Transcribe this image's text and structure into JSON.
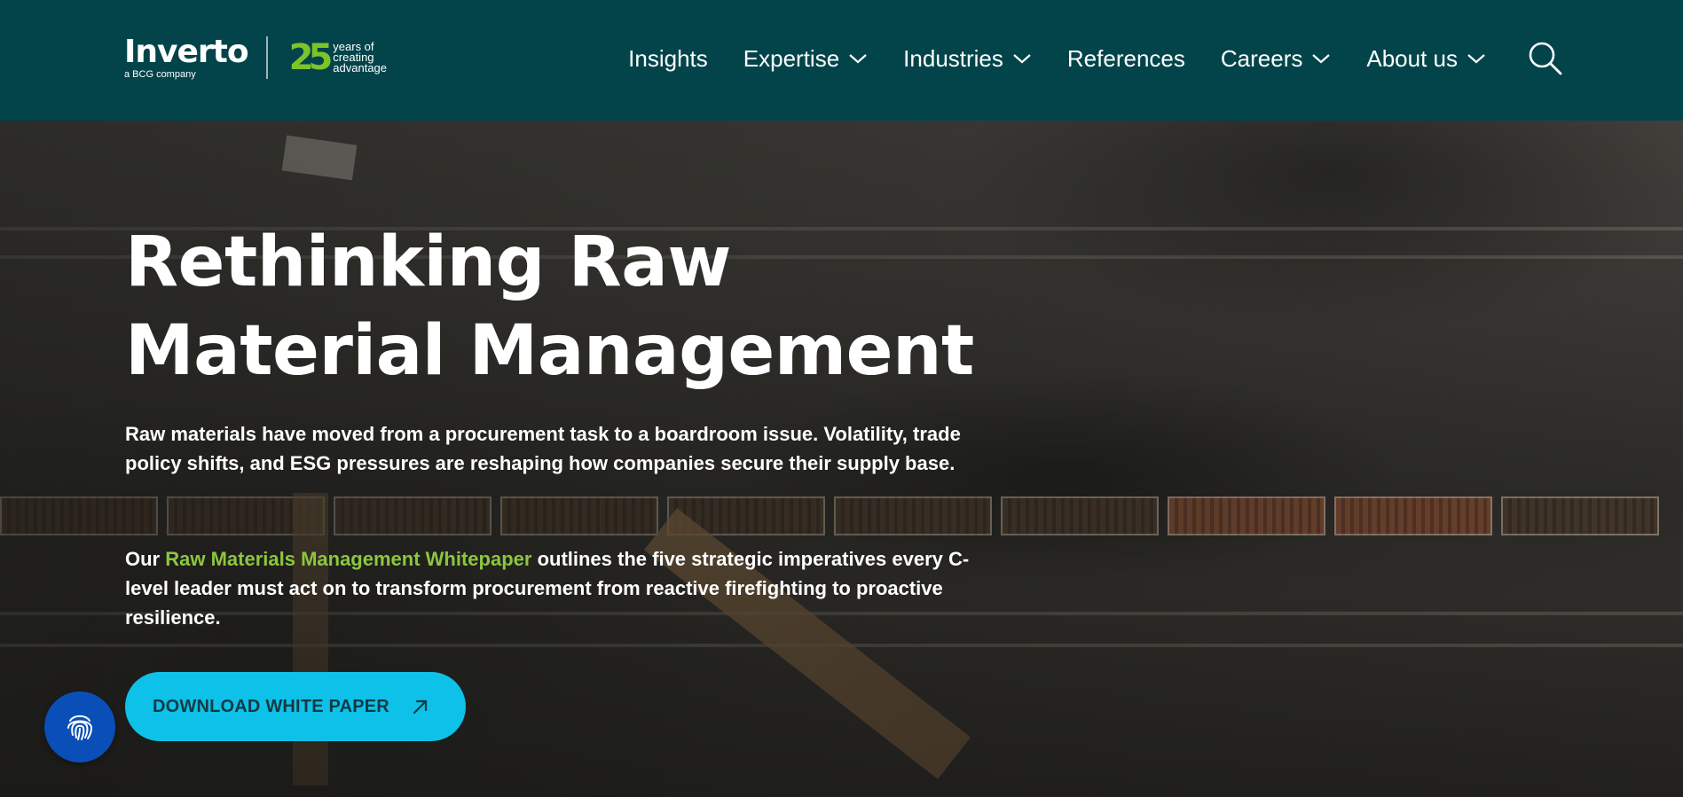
{
  "header": {
    "logo": {
      "name": "Inverto",
      "tagline": "a BCG company"
    },
    "anniversary": {
      "number": "25",
      "lines": [
        "years of",
        "creating",
        "advantage"
      ]
    },
    "nav": [
      {
        "label": "Insights",
        "has_dropdown": false
      },
      {
        "label": "Expertise",
        "has_dropdown": true
      },
      {
        "label": "Industries",
        "has_dropdown": true
      },
      {
        "label": "References",
        "has_dropdown": false
      },
      {
        "label": "Careers",
        "has_dropdown": true
      },
      {
        "label": "About us",
        "has_dropdown": true
      }
    ],
    "search_icon": "search-icon"
  },
  "hero": {
    "title_line1": "Rethinking Raw",
    "title_line2": "Material Management",
    "paragraph1": "Raw materials have moved from a procurement task to a boardroom issue. Volatility, trade policy shifts, and ESG pressures are reshaping how companies secure their supply base.",
    "paragraph2_prefix": "Our ",
    "paragraph2_link": "Raw Materials Management Whitepaper",
    "paragraph2_suffix": " outlines the five strategic imperatives every C-level leader must act on to transform procurement from reactive firefighting to proactive resilience.",
    "cta_label": "DOWNLOAD WHITE PAPER",
    "cta_icon": "arrow-up-right-icon"
  },
  "floating": {
    "icon": "fingerprint-icon"
  },
  "colors": {
    "header_bg": "#02444a",
    "accent_green": "#8cc63f",
    "cta_bg": "#0ec1e8",
    "fingerprint_bg": "#0a4fb8"
  }
}
